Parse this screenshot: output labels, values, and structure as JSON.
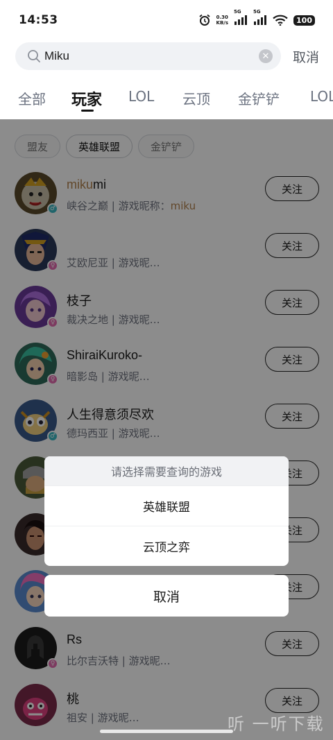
{
  "status_bar": {
    "time": "14:53",
    "net_speed_value": "0.30",
    "net_speed_unit": "KB/s",
    "signal1_label": "5G",
    "signal2_label": "5G",
    "battery": "100"
  },
  "search": {
    "value": "Miku",
    "placeholder": "",
    "cancel_label": "取消"
  },
  "tabs": [
    {
      "label": "全部"
    },
    {
      "label": "玩家"
    },
    {
      "label": "LOL"
    },
    {
      "label": "云顶"
    },
    {
      "label": "金铲铲"
    },
    {
      "label": "LOL"
    }
  ],
  "active_tab_index": 1,
  "filter_chips": [
    {
      "label": "盟友"
    },
    {
      "label": "英雄联盟"
    },
    {
      "label": "金铲铲"
    }
  ],
  "players": [
    {
      "name_hl": "miku",
      "name_rest": "mi",
      "server": "峡谷之巅",
      "sub_sep": " | 游戏昵称：",
      "sub_hl": "miku",
      "follow": "关注",
      "gender": "♂"
    },
    {
      "name_hl": "",
      "name_rest": "",
      "server": "艾欧尼亚",
      "sub_sep": " | 游戏昵…",
      "sub_hl": "",
      "follow": "关注",
      "gender": "♀"
    },
    {
      "name_hl": "",
      "name_rest": "枝子",
      "server": "裁决之地",
      "sub_sep": " | 游戏昵…",
      "sub_hl": "",
      "follow": "关注",
      "gender": "♀"
    },
    {
      "name_hl": "",
      "name_rest": "ShiraiKuroko-",
      "server": "暗影岛",
      "sub_sep": " | 游戏昵…",
      "sub_hl": "",
      "follow": "关注",
      "gender": "♀"
    },
    {
      "name_hl": "",
      "name_rest": "人生得意须尽欢",
      "server": "德玛西亚",
      "sub_sep": " | 游戏昵…",
      "sub_hl": "",
      "follow": "关注",
      "gender": "♂"
    },
    {
      "name_hl": "",
      "name_rest": "",
      "server": "",
      "sub_sep": "",
      "sub_hl": "",
      "follow": "关注",
      "gender": ""
    },
    {
      "name_hl": "",
      "name_rest": "",
      "server": "",
      "sub_sep": "",
      "sub_hl": "",
      "follow": "关注",
      "gender": ""
    },
    {
      "name_hl": "",
      "name_rest": "",
      "server": "",
      "sub_sep": "",
      "sub_hl": "",
      "follow": "关注",
      "gender": ""
    },
    {
      "name_hl": "",
      "name_rest": "Rs",
      "server": "比尔吉沃特",
      "sub_sep": " | 游戏昵…",
      "sub_hl": "",
      "follow": "关注",
      "gender": "♀"
    },
    {
      "name_hl": "",
      "name_rest": "桃",
      "server": "祖安",
      "sub_sep": " | 游戏昵…",
      "sub_hl": "",
      "follow": "关注",
      "gender": ""
    }
  ],
  "action_sheet": {
    "title": "请选择需要查询的游戏",
    "options": [
      {
        "label": "英雄联盟"
      },
      {
        "label": "云顶之弈"
      }
    ],
    "cancel_label": "取消"
  },
  "watermark": "听 一听下载",
  "colors": {
    "highlight": "#b3834f",
    "overlay": "rgba(0,0,0,0.45)",
    "male_badge": "#3bb9c4",
    "female_badge": "#e36bb0"
  }
}
